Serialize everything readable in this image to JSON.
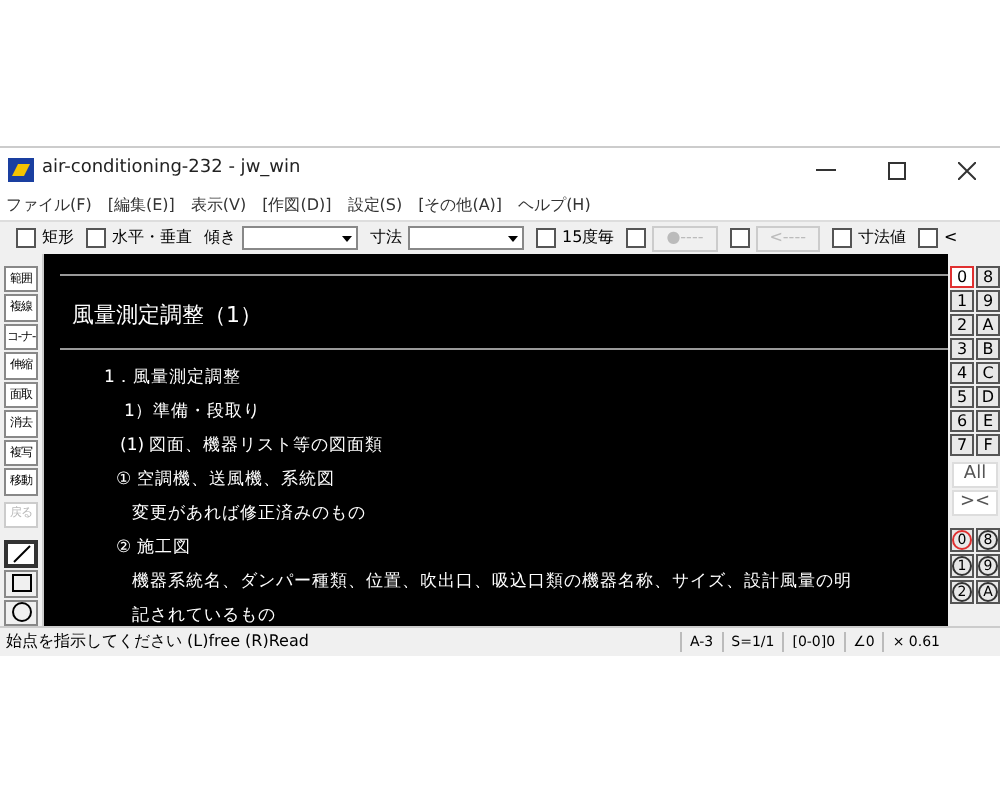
{
  "window": {
    "title": "air-conditioning-232 - jw_win"
  },
  "menu": [
    "ファイル(F)",
    "[編集(E)]",
    "表示(V)",
    "[作図(D)]",
    "設定(S)",
    "[その他(A)]",
    "ヘルプ(H)"
  ],
  "toolbar": [
    {
      "kind": "check",
      "label": "矩形",
      "checked": false
    },
    {
      "kind": "check",
      "label": "水平・垂直",
      "checked": false
    },
    {
      "kind": "combo",
      "label": "傾き"
    },
    {
      "kind": "combo",
      "label": "寸法"
    },
    {
      "kind": "check",
      "label": "15度毎",
      "checked": false
    },
    {
      "kind": "checkbutton",
      "label": "●----",
      "checked": false,
      "disabled": true
    },
    {
      "kind": "checkbutton",
      "label": "<----",
      "checked": false,
      "disabled": true
    },
    {
      "kind": "check",
      "label": "寸法値",
      "checked": false
    },
    {
      "kind": "check",
      "label": "<",
      "checked": false
    }
  ],
  "tools": [
    {
      "label": "範囲",
      "disabled": false
    },
    {
      "label": "複線",
      "disabled": false
    },
    {
      "label": "コ-ナ-",
      "disabled": false
    },
    {
      "label": "伸縮",
      "disabled": false
    },
    {
      "label": "面取",
      "disabled": false
    },
    {
      "label": "消去",
      "disabled": false
    },
    {
      "label": "複写",
      "disabled": false
    },
    {
      "label": "移動",
      "disabled": false
    },
    {
      "label": "戻る",
      "disabled": true
    }
  ],
  "draw_tools": [
    {
      "kind": "line",
      "selected": true
    },
    {
      "kind": "rect",
      "selected": false
    },
    {
      "kind": "circle",
      "selected": false
    }
  ],
  "canvas": {
    "heading": "風量測定調整（1）",
    "outline": [
      {
        "text": "1．風量測定調整",
        "children": [
          {
            "text": "1）準備・段取り",
            "children": [
              {
                "text": "(1) 図面、機器リスト等の図面類",
                "children": [
                  {
                    "text": "① 空調機、送風機、系統図",
                    "children": [
                      {
                        "text": "変更があれば修正済みのもの"
                      }
                    ]
                  },
                  {
                    "text": "② 施工図",
                    "children": [
                      {
                        "text": "機器系統名、ダンパー種類、位置、吹出口、吸込口類の機器名称、サイズ、設計風量の明"
                      },
                      {
                        "text": "記されているもの"
                      }
                    ]
                  }
                ]
              }
            ]
          }
        ]
      }
    ]
  },
  "layers": [
    {
      "label": "0",
      "selected": true
    },
    {
      "label": "8",
      "selected": false
    },
    {
      "label": "1",
      "selected": false
    },
    {
      "label": "9",
      "selected": false
    },
    {
      "label": "2",
      "selected": false
    },
    {
      "label": "A",
      "selected": false
    },
    {
      "label": "3",
      "selected": false
    },
    {
      "label": "B",
      "selected": false
    },
    {
      "label": "4",
      "selected": false
    },
    {
      "label": "C",
      "selected": false
    },
    {
      "label": "5",
      "selected": false
    },
    {
      "label": "D",
      "selected": false
    },
    {
      "label": "6",
      "selected": false
    },
    {
      "label": "E",
      "selected": false
    },
    {
      "label": "7",
      "selected": false
    },
    {
      "label": "F",
      "selected": false
    }
  ],
  "layer_buttons": [
    "All",
    "><"
  ],
  "layer_groups": [
    {
      "label": "0",
      "selected": true
    },
    {
      "label": "8",
      "selected": false
    },
    {
      "label": "1",
      "selected": false
    },
    {
      "label": "9",
      "selected": false
    },
    {
      "label": "2",
      "selected": false
    },
    {
      "label": "A",
      "selected": false
    }
  ],
  "status_bar": {
    "message": "始点を指示してください (L)free (R)Read",
    "fields": [
      "A-3",
      "S=1/1",
      "[0-0]0",
      "∠0",
      "× 0.61"
    ]
  }
}
